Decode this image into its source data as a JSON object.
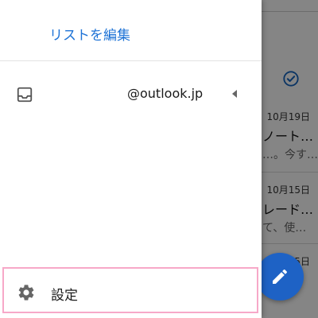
{
  "drawer": {
    "edit_list_label": "リストを編集",
    "account_email": "@outlook.jp",
    "settings_label": "設定"
  },
  "background": {
    "messages": [
      {
        "date": "10月19日",
        "sender": "ノート…",
        "preview": "…。今す…"
      },
      {
        "date": "10月15日",
        "sender": "レード…",
        "preview": "て、使…"
      },
      {
        "date": "5日",
        "sender": "",
        "preview": ""
      }
    ]
  },
  "colors": {
    "accent": "#1e73d6",
    "fab": "#1e62c5",
    "highlight_border": "#f7a8c8"
  },
  "icons": {
    "inbox": "inbox-icon",
    "settings": "gear-icon",
    "caret": "caret-left-icon",
    "compose": "pencil-icon",
    "done": "check-circle-icon"
  }
}
